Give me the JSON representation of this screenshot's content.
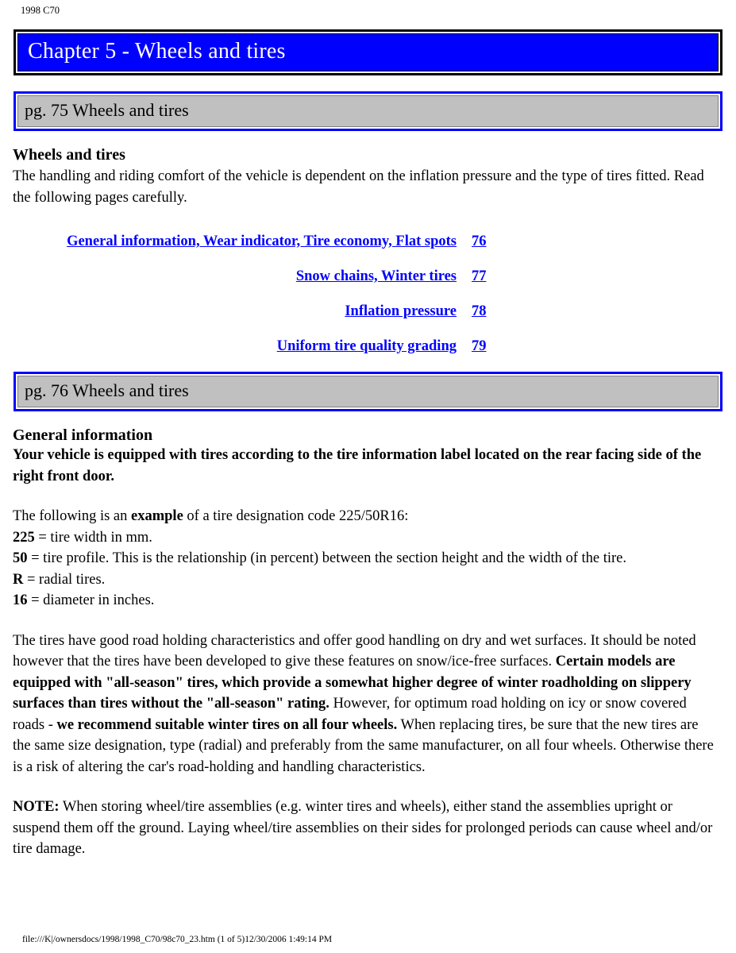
{
  "running_head": "1998 C70",
  "chapter_banner": {
    "title": "Chapter 5 - Wheels and tires",
    "background_color": "#0000ff",
    "text_color": "#ffffff",
    "border_color": "#000000"
  },
  "sections": [
    {
      "page_banner": "pg. 75 Wheels and tires",
      "heading": "Wheels and tires",
      "intro": "The handling and riding comfort of the vehicle is dependent on the inflation pressure and the type of tires fitted. Read the following pages carefully.",
      "toc": [
        {
          "label": "General information, Wear indicator, Tire economy, Flat spots",
          "page": "76"
        },
        {
          "label": "Snow chains, Winter tires",
          "page": "77"
        },
        {
          "label": "Inflation pressure",
          "page": "78"
        },
        {
          "label": "Uniform tire quality grading",
          "page": "79"
        }
      ]
    },
    {
      "page_banner": "pg. 76 Wheels and tires",
      "heading": "General information",
      "lead_bold": "Your vehicle is equipped with tires according to the tire information label located on the rear facing side of the right front door.",
      "designation": {
        "line_prefix": "The following is an ",
        "line_bold": "example",
        "line_suffix": " of a tire designation code 225/50R16:",
        "items": [
          {
            "code": "225",
            "desc": " = tire width in mm."
          },
          {
            "code": "50",
            "desc": " = tire profile. This is the relationship (in percent) between the section height and the width of the tire."
          },
          {
            "code": "R",
            "desc": " = radial tires."
          },
          {
            "code": "16",
            "desc": " = diameter in inches."
          }
        ]
      },
      "paragraph_mixed": {
        "p1": "The tires have good road holding characteristics and offer good handling on dry and wet surfaces. It should be noted however that the tires have been developed to give these features on snow/ice-free surfaces. ",
        "b1": "Certain models are equipped with \"all-season\" tires, which provide a somewhat higher degree of winter roadholding on slippery surfaces than tires without the \"all-season\" rating.",
        "p2": " However, for optimum road holding on icy or snow covered roads - ",
        "b2": "we recommend suitable winter tires on all four wheels.",
        "p3": " When replacing tires, be sure that the new tires are the same size designation, type (radial) and preferably from the same manufacturer, on all four wheels. Otherwise there is a risk of altering the car's road-holding and handling characteristics."
      },
      "note": {
        "label": "NOTE:",
        "text": " When storing wheel/tire assemblies (e.g. winter tires and wheels), either stand the assemblies upright or suspend them off the ground. Laying wheel/tire assemblies on their sides for prolonged periods can cause wheel and/or tire damage."
      }
    }
  ],
  "footer": "file:///K|/ownersdocs/1998/1998_C70/98c70_23.htm (1 of 5)12/30/2006 1:49:14 PM"
}
